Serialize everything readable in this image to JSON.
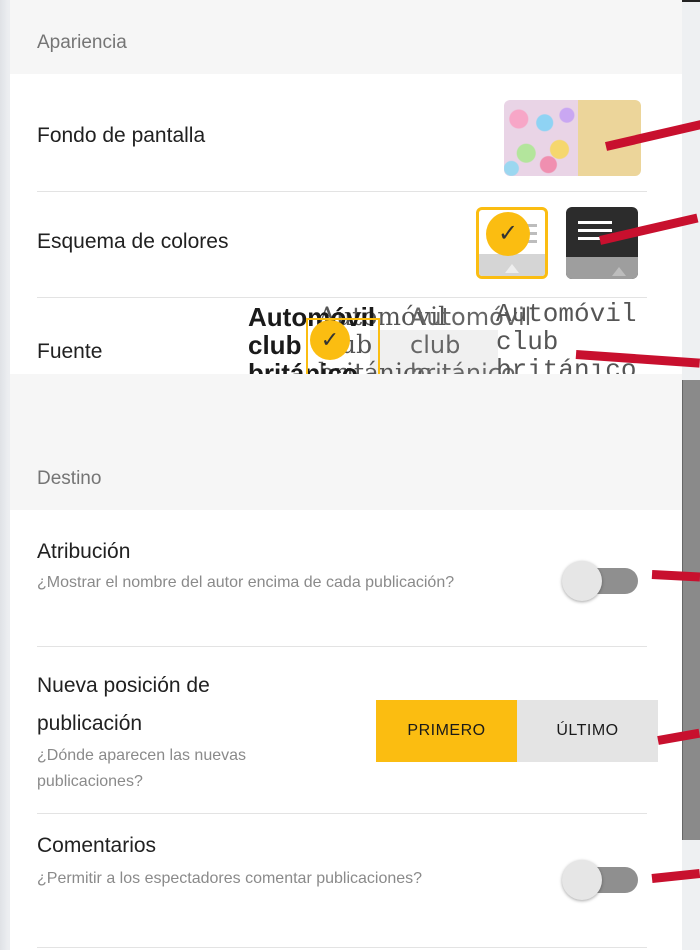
{
  "sections": {
    "appearance": "Apariencia",
    "destination": "Destino"
  },
  "appearance": {
    "wallpaper_label": "Fondo de pantalla",
    "color_scheme_label": "Esquema de colores",
    "font_label": "Fuente",
    "font_preview_lines": [
      "Automóvil",
      "club",
      "británico"
    ],
    "font_previews": {
      "bold": "Automóvil\nclub\nbritánico",
      "serif": "Automóvil\nclub\nbritánico",
      "sans": "Automóvil\nclub\nbritánico",
      "mono": "Automóvil\nclub\nbritánico"
    }
  },
  "destination": {
    "attribution_label": "Atribución",
    "attribution_desc": "¿Mostrar el nombre del autor encima de cada publicación?",
    "new_position_label": "Nueva posición de publicación",
    "new_position_desc": "¿Dónde aparecen las nuevas publicaciones?",
    "position_first": "PRIMERO",
    "position_last": "ÚLTIMO",
    "comments_label": "Comentarios",
    "comments_desc": "¿Permitir a los espectadores comentar publicaciones?"
  },
  "colors": {
    "accent": "#fbbd11",
    "arrow": "#c8102e",
    "wallpaper_swatch": "#ecd59a"
  },
  "state": {
    "attribution_enabled": false,
    "comments_enabled": false,
    "new_position_selected": "PRIMERO",
    "color_scheme_selected": "light"
  }
}
